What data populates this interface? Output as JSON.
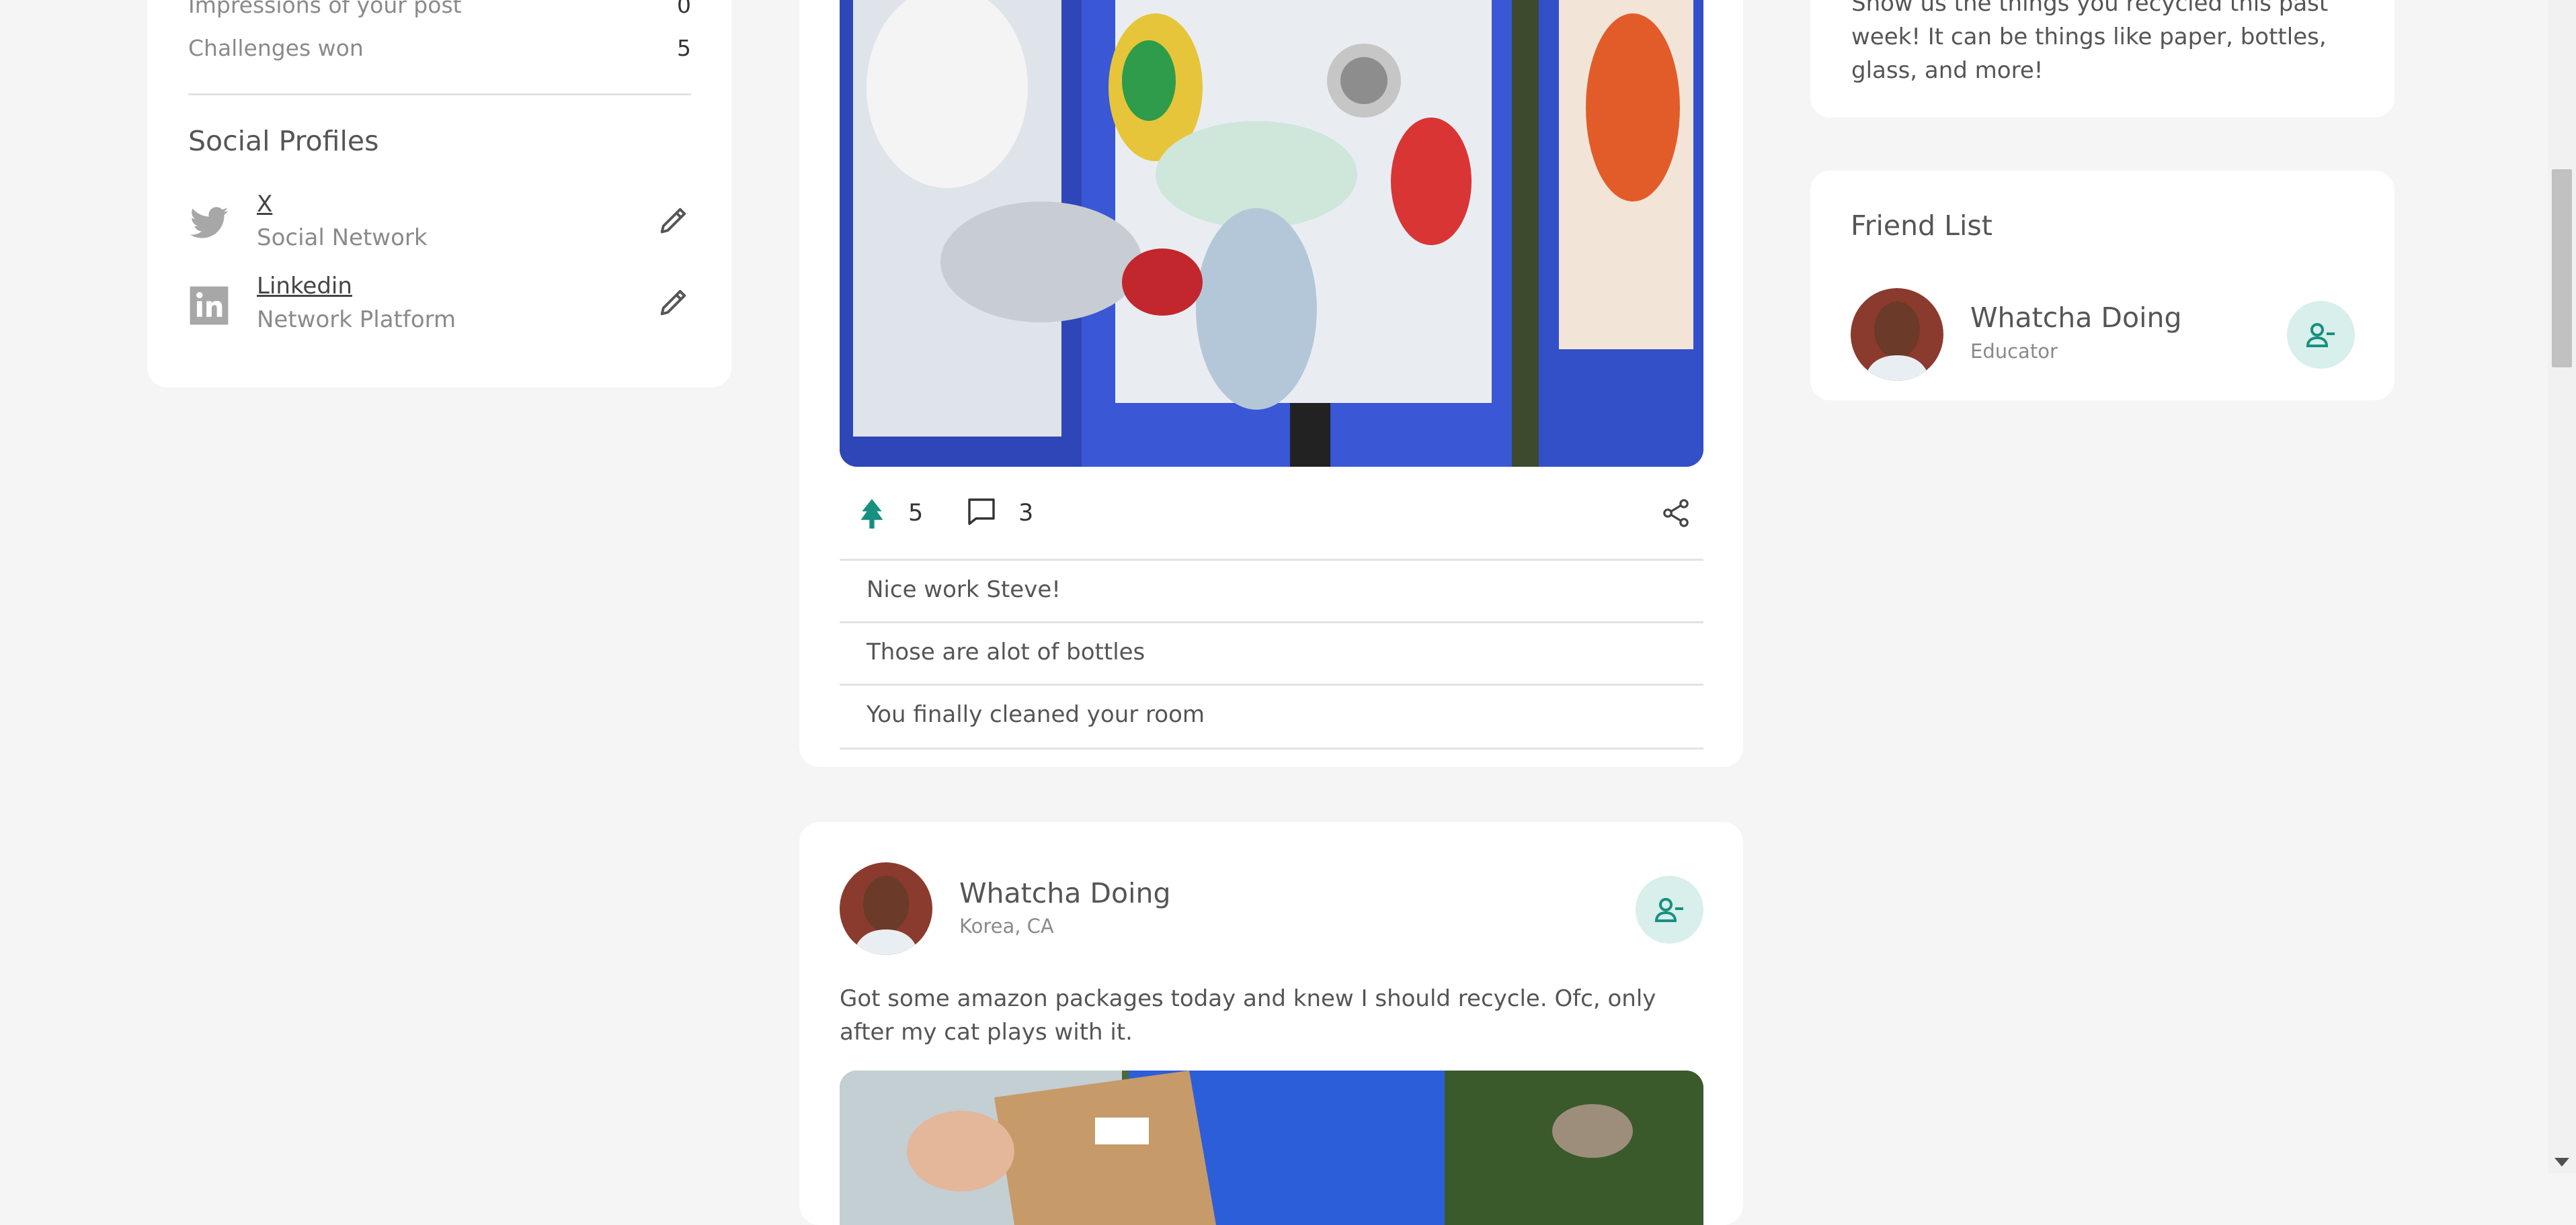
{
  "stats": {
    "impressions_label": "Impressions of your post",
    "impressions_value": "0",
    "challenges_label": "Challenges won",
    "challenges_value": "5"
  },
  "social_profiles": {
    "title": "Social Profiles",
    "items": [
      {
        "name": "X",
        "subtitle": "Social Network",
        "icon": "twitter-icon"
      },
      {
        "name": "Linkedin",
        "subtitle": "Network Platform",
        "icon": "linkedin-icon"
      }
    ]
  },
  "post1": {
    "likes": "5",
    "comments_count": "3",
    "comments": [
      "Nice work Steve!",
      "Those are alot of bottles",
      "You finally cleaned your room"
    ]
  },
  "post2": {
    "author": "Whatcha Doing",
    "location": "Korea, CA",
    "text": "Got some amazon packages today and knew I should recycle. Ofc, only after my cat plays with it."
  },
  "challenge_prompt": {
    "text": "Show us the things you recycled this past week! It can be things like paper, bottles, glass, and more!"
  },
  "friend_list": {
    "title": "Friend List",
    "friends": [
      {
        "name": "Whatcha Doing",
        "role": "Educator"
      }
    ]
  },
  "colors": {
    "accent": "#17907f",
    "accent_light": "#d8efec",
    "background": "#f5f5f5",
    "card": "#ffffff"
  }
}
